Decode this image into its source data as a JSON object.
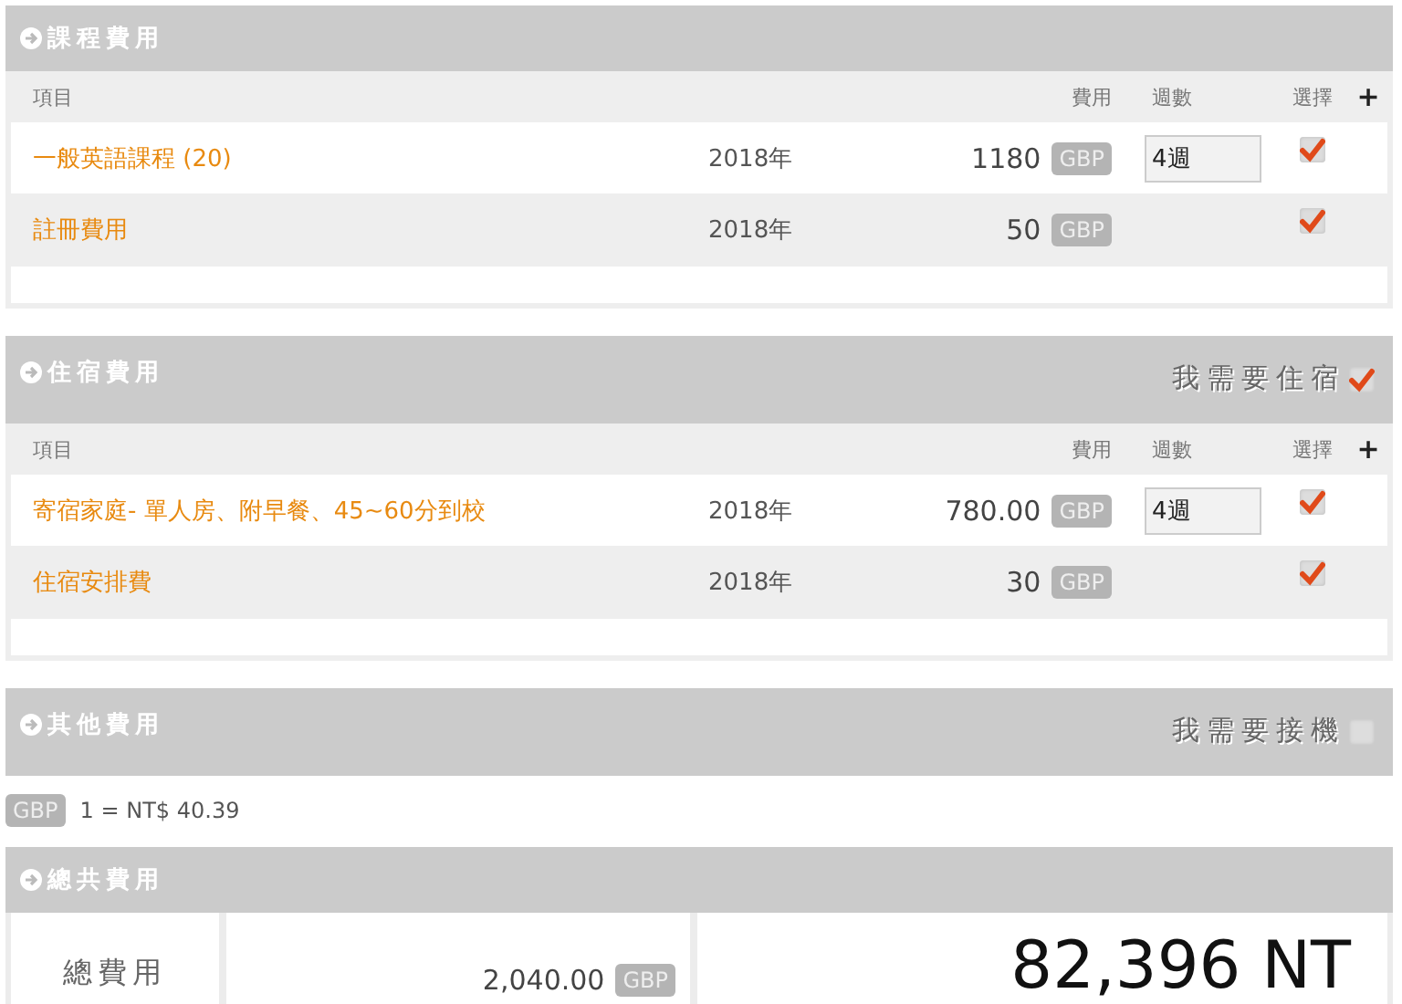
{
  "sections": [
    {
      "title": "課程費用",
      "columns": {
        "item": "項目",
        "cost": "費用",
        "weeks": "週數",
        "select": "選擇",
        "add": "+"
      },
      "rows": [
        {
          "name": "一般英語課程 (20)",
          "year": "2018年",
          "cost": "1180",
          "currency": "GBP",
          "weeks": "4週",
          "checked": true
        },
        {
          "name": "註冊費用",
          "year": "2018年",
          "cost": "50",
          "currency": "GBP",
          "checked": true
        }
      ]
    },
    {
      "title": "住宿費用",
      "option": {
        "label": "我需要住宿",
        "checked": true
      },
      "columns": {
        "item": "項目",
        "cost": "費用",
        "weeks": "週數",
        "select": "選擇",
        "add": "+"
      },
      "rows": [
        {
          "name": "寄宿家庭- 單人房、附早餐、45~60分到校",
          "year": "2018年",
          "cost": "780.00",
          "currency": "GBP",
          "weeks": "4週",
          "checked": true
        },
        {
          "name": "住宿安排費",
          "year": "2018年",
          "cost": "30",
          "currency": "GBP",
          "checked": true
        }
      ]
    },
    {
      "title": "其他費用",
      "option": {
        "label": "我需要接機",
        "checked": false
      }
    }
  ],
  "rate": {
    "currency": "GBP",
    "text": "1 = NT$ 40.39"
  },
  "total": {
    "title": "總共費用",
    "label": "總費用",
    "amount": "2,040.00",
    "currency": "GBP",
    "converted": "82,396 NT"
  }
}
